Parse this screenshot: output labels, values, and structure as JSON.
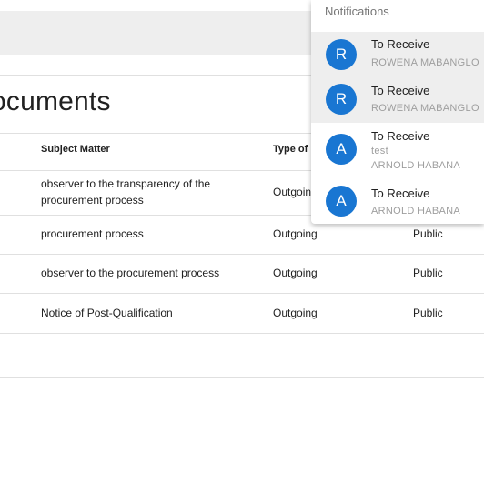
{
  "page": {
    "title": "ocuments"
  },
  "table": {
    "columns": [
      "Subject Matter",
      "Type of D"
    ],
    "rows": [
      {
        "subject": "observer to the transparency of the procurement process",
        "type": "Outgoing",
        "access": ""
      },
      {
        "subject": "procurement process",
        "type": "Outgoing",
        "access": "Public"
      },
      {
        "subject": "observer to the procurement process",
        "type": "Outgoing",
        "access": "Public"
      },
      {
        "subject": "Notice of Post-Qualification",
        "type": "Outgoing",
        "access": "Public"
      }
    ]
  },
  "notifications": {
    "title": "Notifications",
    "items": [
      {
        "initial": "R",
        "title": "To Receive",
        "note": "",
        "from": "ROWENA MABANGLO"
      },
      {
        "initial": "R",
        "title": "To Receive",
        "note": "",
        "from": "ROWENA MABANGLO"
      },
      {
        "initial": "A",
        "title": "To Receive",
        "note": "test",
        "from": "ARNOLD HABANA"
      },
      {
        "initial": "A",
        "title": "To Receive",
        "note": "",
        "from": "ARNOLD HABANA"
      }
    ]
  },
  "colors": {
    "avatar": "#1976d2",
    "highlight": "#eeeeee"
  }
}
